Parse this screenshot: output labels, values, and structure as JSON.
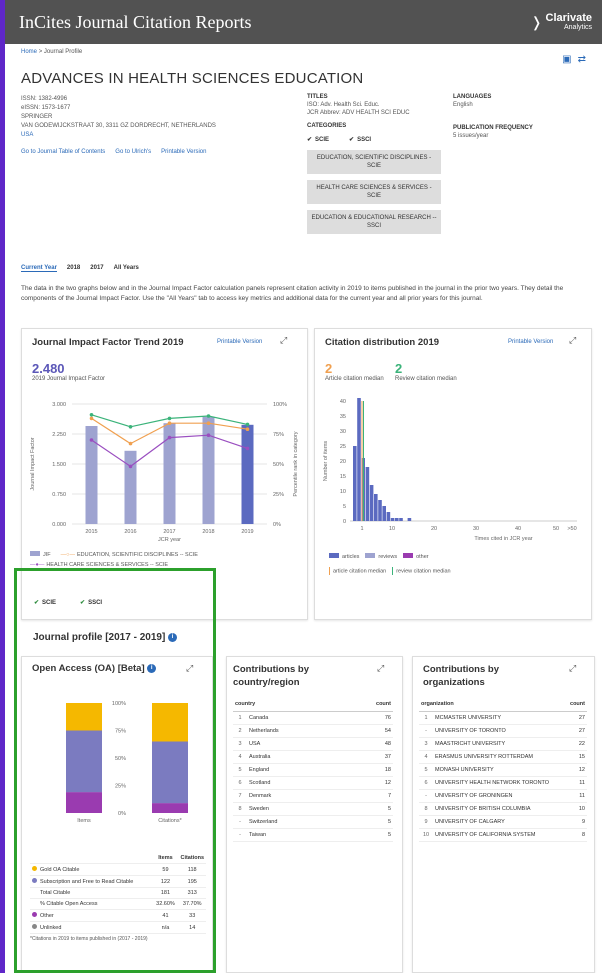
{
  "header": {
    "brand": "InCites Journal Citation Reports",
    "logo_main": "Clarivate",
    "logo_sub": "Analytics"
  },
  "breadcrumb": {
    "home": "Home",
    "sep": ">",
    "current": "Journal Profile"
  },
  "journal": {
    "title": "ADVANCES IN HEALTH SCIENCES EDUCATION",
    "issn": "ISSN: 1382-4996",
    "eissn": "eISSN: 1573-1677",
    "publisher": "SPRINGER",
    "address": "VAN GODEWIJCKSTRAAT 30, 3311 GZ DORDRECHT, NETHERLANDS",
    "country": "USA",
    "links": [
      "Go to Journal Table of Contents",
      "Go to Ulrich's",
      "Printable Version"
    ],
    "titles_label": "TITLES",
    "iso": "ISO: Adv. Health Sci. Educ.",
    "jcr": "JCR Abbrev: ADV HEALTH SCI EDUC",
    "categories_label": "CATEGORIES",
    "cat_scie": "SCIE",
    "cat_ssci": "SSCI",
    "categories": [
      "EDUCATION, SCIENTIFIC DISCIPLINES - SCIE",
      "HEALTH CARE SCIENCES & SERVICES - SCIE",
      "EDUCATION & EDUCATIONAL RESEARCH -- SSCI"
    ],
    "languages_label": "LANGUAGES",
    "language": "English",
    "freq_label": "PUBLICATION FREQUENCY",
    "freq": "5 issues/year"
  },
  "tabs": [
    "Current Year",
    "2018",
    "2017",
    "All Years"
  ],
  "description": "The data in the two graphs below and in the Journal Impact Factor calculation panels represent citation activity in 2019 to items published in the journal in the prior two years. They detail the components of the Journal Impact Factor. Use the \"All Years\" tab to access key metrics and additional data for the current year and all prior years for this journal.",
  "jif_panel": {
    "title": "Journal Impact Factor Trend 2019",
    "link": "Printable Version",
    "value": "2.480",
    "value_label": "2019 Journal Impact Factor",
    "ylabel": "Journal Impact Factor",
    "y2label": "Percentile rank in category",
    "xlabel": "JCR year",
    "legend_jif": "JIF",
    "legend_edu": "EDUCATION, SCIENTIFIC DISCIPLINES -- SCIE",
    "legend_hc": "HEALTH CARE SCIENCES & SERVICES -- SCIE",
    "scie": "SCIE",
    "ssci": "SSCI",
    "colors": {
      "jif": "#9ea3d0",
      "edu": "#f0a050",
      "hc": "#9a4ec0",
      "ssci": "#3bb37a"
    }
  },
  "cit_panel": {
    "title": "Citation distribution 2019",
    "link": "Printable Version",
    "article_median": "2",
    "article_label": "Article citation median",
    "review_median": "2",
    "review_label": "Review citation median",
    "ylabel": "Number of items",
    "xlabel": "Times cited in JCR year",
    "legend": [
      "articles",
      "reviews",
      "other"
    ],
    "legend_lines": [
      "article citation median",
      "review citation median"
    ]
  },
  "profile_title": "Journal profile [2017 - 2019]",
  "oa_panel": {
    "title": "Open Access (OA) [Beta]",
    "col1": "Items",
    "col2": "Citations",
    "rows": [
      {
        "label": "Gold OA Citable",
        "items": "59",
        "cit": "118",
        "color": "#f5b800"
      },
      {
        "label": "Subscription and Free to Read Citable",
        "items": "122",
        "cit": "195",
        "color": "#7b7bc0"
      },
      {
        "label": "Total Citable",
        "items": "181",
        "cit": "313",
        "color": ""
      },
      {
        "label": "% Citable Open Access",
        "items": "32.60%",
        "cit": "37.70%",
        "color": ""
      },
      {
        "label": "Other",
        "items": "41",
        "cit": "33",
        "color": "#9a3bb0"
      },
      {
        "label": "Unlinked",
        "items": "n/a",
        "cit": "14",
        "color": "#888888"
      }
    ],
    "footnote": "*Citations in 2019 to items published in (2017 - 2019)"
  },
  "country_panel": {
    "title": "Contributions by country/region",
    "h1": "country",
    "h2": "count",
    "rows": [
      [
        "1",
        "Canada",
        "76"
      ],
      [
        "2",
        "Netherlands",
        "54"
      ],
      [
        "3",
        "USA",
        "48"
      ],
      [
        "4",
        "Australia",
        "37"
      ],
      [
        "5",
        "England",
        "18"
      ],
      [
        "6",
        "Scotland",
        "12"
      ],
      [
        "7",
        "Denmark",
        "7"
      ],
      [
        "8",
        "Sweden",
        "5"
      ],
      [
        "-",
        "Switzerland",
        "5"
      ],
      [
        "-",
        "Taiwan",
        "5"
      ]
    ]
  },
  "org_panel": {
    "title": "Contributions by organizations",
    "h1": "organization",
    "h2": "count",
    "rows": [
      [
        "1",
        "MCMASTER UNIVERSITY",
        "27"
      ],
      [
        "-",
        "UNIVERSITY OF TORONTO",
        "27"
      ],
      [
        "3",
        "MAASTRICHT UNIVERSITY",
        "22"
      ],
      [
        "4",
        "ERASMUS UNIVERSITY ROTTERDAM",
        "15"
      ],
      [
        "5",
        "MONASH UNIVERSITY",
        "12"
      ],
      [
        "6",
        "UNIVERSITY HEALTH NETWORK TORONTO",
        "11"
      ],
      [
        "-",
        "UNIVERSITY OF GRONINGEN",
        "11"
      ],
      [
        "8",
        "UNIVERSITY OF BRITISH COLUMBIA",
        "10"
      ],
      [
        "9",
        "UNIVERSITY OF CALGARY",
        "9"
      ],
      [
        "10",
        "UNIVERSITY OF CALIFORNIA SYSTEM",
        "8"
      ]
    ]
  },
  "chart_data": [
    {
      "type": "bar",
      "title": "Journal Impact Factor Trend 2019",
      "categories": [
        "2015",
        "2016",
        "2017",
        "2018",
        "2019"
      ],
      "ylim": [
        0,
        3
      ],
      "yticks": [
        "0.000",
        "0.750",
        "1.500",
        "2.250",
        "3.000"
      ],
      "y2ticks": [
        "0%",
        "25%",
        "50%",
        "75%",
        "100%"
      ],
      "series": [
        {
          "name": "JIF",
          "values": [
            2.45,
            1.83,
            2.52,
            2.68,
            2.48
          ]
        },
        {
          "name": "EDUCATION, SCIENTIFIC DISCIPLINES -- SCIE",
          "axis": "percent",
          "values": [
            88,
            67,
            84,
            84,
            79
          ]
        },
        {
          "name": "HEALTH CARE SCIENCES & SERVICES -- SCIE",
          "axis": "percent",
          "values": [
            70,
            48,
            72,
            74,
            63
          ]
        },
        {
          "name": "SSCI",
          "axis": "percent",
          "values": [
            91,
            81,
            88,
            90,
            83
          ]
        }
      ]
    },
    {
      "type": "bar",
      "title": "Citation distribution 2019",
      "xticks": [
        "0",
        "1",
        "10",
        "20",
        "30",
        "40",
        "50",
        ">50"
      ],
      "yticks": [
        "0",
        "5",
        "10",
        "15",
        "20",
        "25",
        "30",
        "35",
        "40"
      ],
      "ylim": [
        0,
        40
      ],
      "series": [
        {
          "name": "articles",
          "x": [
            0,
            1,
            2,
            3,
            4,
            5,
            6,
            7,
            8,
            9,
            10,
            11,
            13
          ],
          "values": [
            25,
            41,
            21,
            18,
            12,
            9,
            7,
            5,
            3,
            1,
            1,
            1,
            1
          ]
        }
      ]
    },
    {
      "type": "bar",
      "title": "Open Access (OA) [Beta]",
      "categories": [
        "Items",
        "Citations*"
      ],
      "yticks": [
        "0%",
        "25%",
        "50%",
        "75%",
        "100%"
      ],
      "series": [
        {
          "name": "Other",
          "values": [
            19,
            9
          ]
        },
        {
          "name": "Subscription and Free to Read Citable",
          "values": [
            56,
            56
          ]
        },
        {
          "name": "Gold OA Citable",
          "values": [
            25,
            35
          ]
        }
      ]
    }
  ]
}
